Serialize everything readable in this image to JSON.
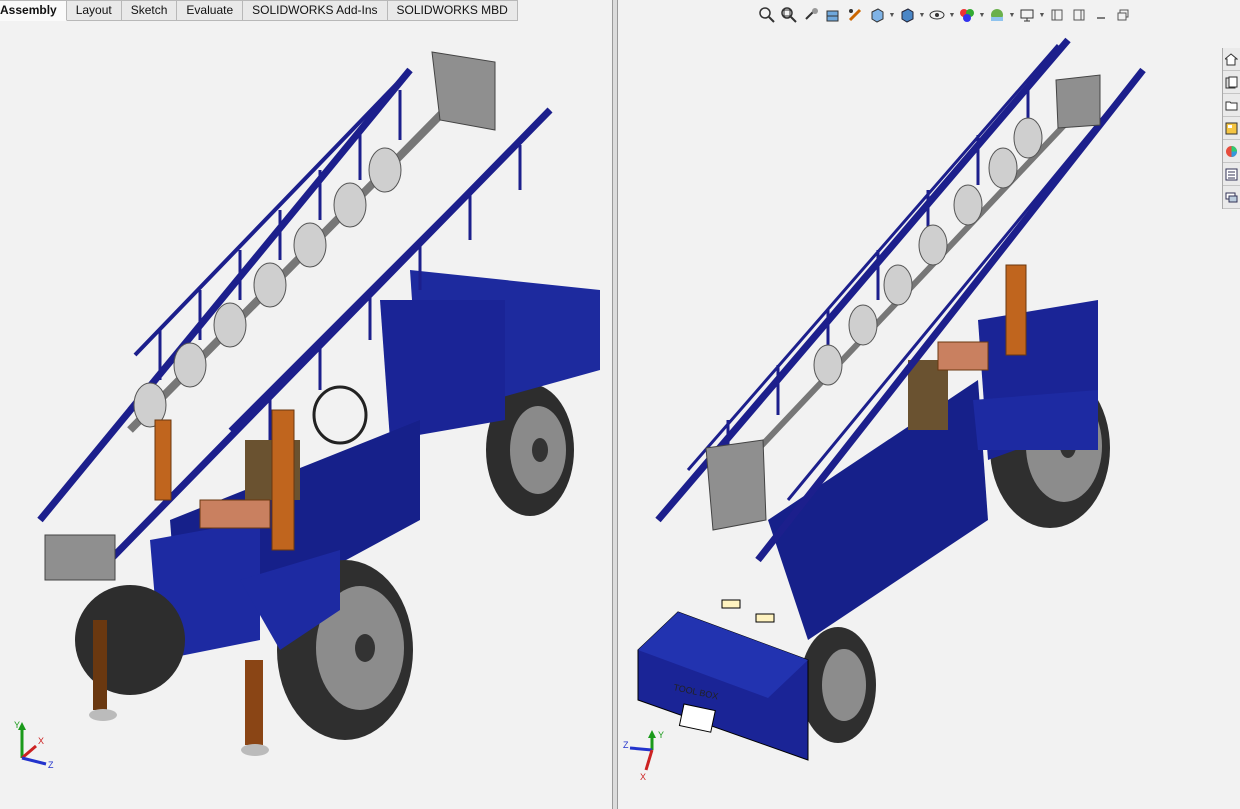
{
  "tabs": [
    {
      "label": "Assembly",
      "active": true
    },
    {
      "label": "Layout",
      "active": false
    },
    {
      "label": "Sketch",
      "active": false
    },
    {
      "label": "Evaluate",
      "active": false
    },
    {
      "label": "SOLIDWORKS Add-Ins",
      "active": false
    },
    {
      "label": "SOLIDWORKS MBD",
      "active": false
    }
  ],
  "heads_up_toolbar": [
    "zoom-to-fit-icon",
    "zoom-to-area-icon",
    "previous-view-icon",
    "section-view-icon",
    "dynamic-annotation-icon",
    "view-orientation-icon",
    "display-style-icon",
    "hide-show-items-icon",
    "edit-appearance-icon",
    "apply-scene-icon",
    "view-settings-icon",
    "minimize-window-icon",
    "restore-window-icon",
    "minimize-icon",
    "maximize-icon"
  ],
  "task_pane": [
    "solidworks-resources-icon",
    "design-library-icon",
    "file-explorer-icon",
    "view-palette-icon",
    "appearances-icon",
    "custom-properties-icon",
    "forum-icon"
  ],
  "colors": {
    "frame_blue": "#1c1f8c",
    "panel_blue": "#1a2a9e",
    "steel_gray": "#9a9a9a",
    "cylinder_orange": "#c0651e",
    "tire_dark": "#3a3a3a",
    "viewport_bg": "#f2f2f2"
  },
  "model_label": {
    "box_text": "TOOL BOX"
  },
  "triad": {
    "x": "X",
    "y": "Y",
    "z": "Z"
  }
}
